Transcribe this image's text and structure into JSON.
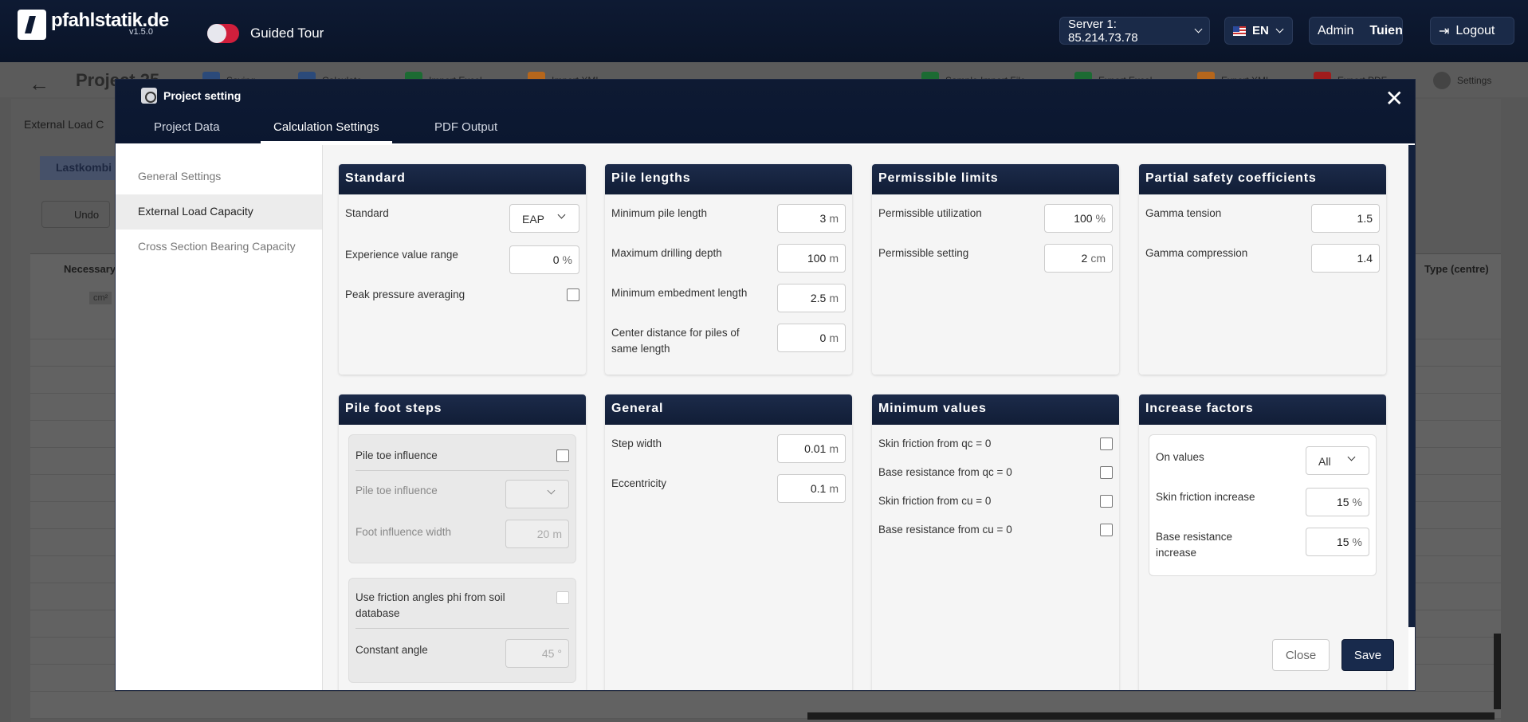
{
  "app": {
    "name": "pfahlstatik.de",
    "version": "v1.5.0",
    "tour_label": "Guided Tour"
  },
  "header": {
    "server": "Server 1: 85.214.73.78",
    "lang": "EN",
    "role": "Admin",
    "user": "Tuien",
    "logout": "Logout"
  },
  "background": {
    "project_title": "Project 25",
    "tools": [
      "Saving",
      "Calculate",
      "Import Excel",
      "Import XML",
      "Sample Import File",
      "Export Excel",
      "Export XML",
      "Export PDF",
      "Settings"
    ],
    "tab": "External Load C",
    "subtab": "Lastkombi",
    "undo": "Undo",
    "col_left": "Necessary",
    "col_right": "Type (centre)",
    "unit_badge": "cm²"
  },
  "modal": {
    "title": "Project setting",
    "tabs": [
      "Project Data",
      "Calculation Settings",
      "PDF Output"
    ],
    "active_tab": "Calculation Settings",
    "sidenav": [
      "General Settings",
      "External Load Capacity",
      "Cross Section Bearing Capacity"
    ],
    "active_nav": "External Load Capacity",
    "close_label": "Close",
    "save_label": "Save"
  },
  "standard": {
    "title": "Standard",
    "standard_label": "Standard",
    "standard_value": "EAP",
    "exp_label": "Experience value range",
    "exp_value": "0",
    "exp_unit": "%",
    "peak_label": "Peak pressure averaging",
    "peak_checked": false
  },
  "pile_lengths": {
    "title": "Pile lengths",
    "min_label": "Minimum pile length",
    "min_value": "3",
    "min_unit": "m",
    "drill_label": "Maximum drilling depth",
    "drill_value": "100",
    "drill_unit": "m",
    "embed_label": "Minimum embedment length",
    "embed_value": "2.5",
    "embed_unit": "m",
    "center_label": "Center distance for piles of same length",
    "center_value": "0",
    "center_unit": "m"
  },
  "permissible": {
    "title": "Permissible limits",
    "util_label": "Permissible utilization",
    "util_value": "100",
    "util_unit": "%",
    "set_label": "Permissible setting",
    "set_value": "2",
    "set_unit": "cm"
  },
  "partial": {
    "title": "Partial safety coefficients",
    "tension_label": "Gamma tension",
    "tension_value": "1.5",
    "compression_label": "Gamma compression",
    "compression_value": "1.4"
  },
  "pile_foot": {
    "title": "Pile foot steps",
    "toe_cb_label": "Pile toe influence",
    "toe_sel_label": "Pile toe influence",
    "toe_sel_value": "",
    "width_label": "Foot influence width",
    "width_value": "20",
    "width_unit": "m",
    "phi_label": "Use friction angles phi from soil database",
    "angle_label": "Constant angle",
    "angle_value": "45",
    "angle_unit": "°"
  },
  "general": {
    "title": "General",
    "step_label": "Step width",
    "step_value": "0.01",
    "step_unit": "m",
    "ecc_label": "Eccentricity",
    "ecc_value": "0.1",
    "ecc_unit": "m"
  },
  "minimum": {
    "title": "Minimum values",
    "items": [
      "Skin friction from qc = 0",
      "Base resistance from qc = 0",
      "Skin friction from cu = 0",
      "Base resistance from cu = 0"
    ]
  },
  "increase": {
    "title": "Increase factors",
    "on_label": "On values",
    "on_value": "All",
    "skin_label": "Skin friction increase",
    "skin_value": "15",
    "skin_unit": "%",
    "base_label": "Base resistance increase",
    "base_value": "15",
    "base_unit": "%"
  },
  "colors": {
    "navy": "#0e1a33",
    "accent": "#d11f3c",
    "save": "#182a4c"
  }
}
